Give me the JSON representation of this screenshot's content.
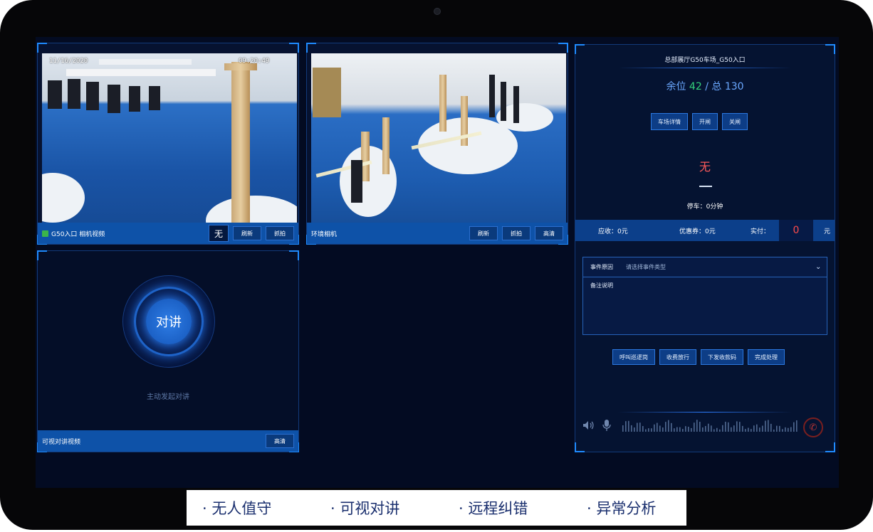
{
  "camera_panel_1": {
    "osd_date": "11/16/2020",
    "osd_time": "09:20:49",
    "title": "G50入口 相机视频",
    "status": "无",
    "buttons": [
      "刷新",
      "抓拍"
    ]
  },
  "camera_panel_2": {
    "title": "环境相机",
    "buttons": [
      "刷新",
      "抓拍",
      "高清"
    ]
  },
  "intercom_panel": {
    "talk_label": "对讲",
    "prompt": "主动发起对讲",
    "title": "可视对讲视频",
    "button": "高清"
  },
  "info_panel": {
    "title": "总部展厅G50车场_G50入口",
    "spaces_label": "余位",
    "spaces_free": "42",
    "separator": "/",
    "total_label": "总",
    "spaces_total": "130",
    "action_buttons": [
      "车场详情",
      "开闸",
      "关闸"
    ],
    "plate": "无",
    "park_time": "停车：0分钟",
    "fees": {
      "receivable": "应收：0元",
      "coupon": "优惠券：0元",
      "paid_label": "实付：",
      "paid_value": "0",
      "unit": "元"
    },
    "event": {
      "cause_label": "事件原因",
      "cause_placeholder": "请选择事件类型",
      "remark_label": "备注说明"
    },
    "process_buttons": [
      "呼叫巡逻岗",
      "收费放行",
      "下发收款码",
      "完成处理"
    ],
    "colors": {
      "free": "#34d27a",
      "plate": "#ff5a5a",
      "paid": "#ff4b4b"
    }
  },
  "features": [
    "· 无人值守",
    "· 可视对讲",
    "· 远程纠错",
    "· 异常分析"
  ]
}
